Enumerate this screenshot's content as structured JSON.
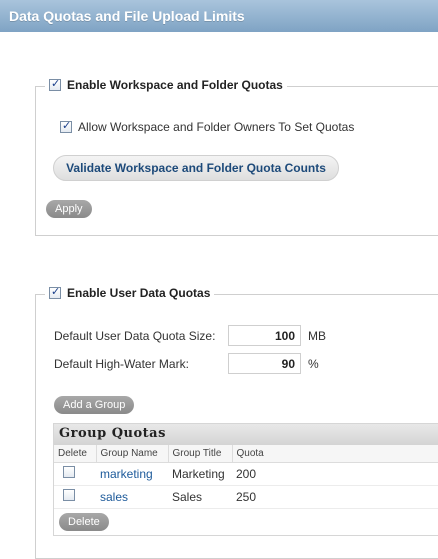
{
  "header": {
    "title": "Data Quotas and File Upload Limits"
  },
  "workspace_section": {
    "legend_label": "Enable Workspace and Folder Quotas",
    "legend_checked": true,
    "allow_owners_label": "Allow Workspace and Folder Owners To Set Quotas",
    "allow_owners_checked": true,
    "validate_button": "Validate Workspace and Folder Quota Counts",
    "apply_button": "Apply"
  },
  "user_section": {
    "legend_label": "Enable User Data Quotas",
    "legend_checked": true,
    "default_size_label": "Default User Data Quota Size:",
    "default_size_value": "100",
    "default_size_unit": "MB",
    "high_water_label": "Default High-Water Mark:",
    "high_water_value": "90",
    "high_water_unit": "%",
    "add_group_button": "Add a Group",
    "group_quotas": {
      "title": "Group Quotas",
      "columns": [
        "Delete",
        "Group Name",
        "Group Title",
        "Quota"
      ],
      "rows": [
        {
          "name": "marketing",
          "title": "Marketing",
          "quota": "200",
          "checked": false
        },
        {
          "name": "sales",
          "title": "Sales",
          "quota": "250",
          "checked": false
        }
      ],
      "delete_button": "Delete"
    }
  }
}
